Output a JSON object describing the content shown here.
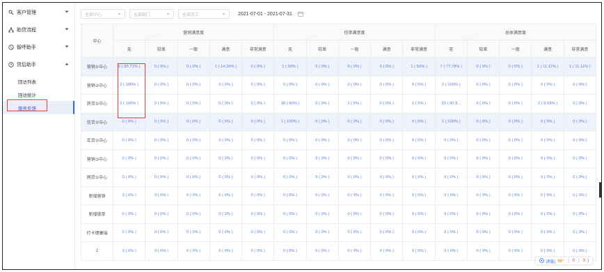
{
  "sidebar": {
    "items": [
      {
        "label": "客户管理",
        "icon": "search-user-icon",
        "expanded": false
      },
      {
        "label": "助贷流程",
        "icon": "org-tree-icon",
        "expanded": false
      },
      {
        "label": "智呼助手",
        "icon": "phone-icon",
        "expanded": false
      },
      {
        "label": "贷后助手",
        "icon": "clock-icon",
        "expanded": true
      }
    ],
    "sub_items": [
      {
        "label": "回访列表",
        "active": false
      },
      {
        "label": "回访统计",
        "active": false
      },
      {
        "label": "服务反馈",
        "active": true
      }
    ]
  },
  "filters": {
    "center_placeholder": "全部中心",
    "dept_placeholder": "全部部门",
    "staff_placeholder": "全部员工",
    "date_range": "2021-07-01 - 2021-07-31"
  },
  "table": {
    "center_header": "中心",
    "groups": [
      "营销满意度",
      "信审满意度",
      "总体满意度"
    ],
    "sub_headers": [
      "无",
      "较差",
      "一般",
      "满意",
      "非常满意"
    ],
    "rows": [
      {
        "name": "营销①中心",
        "highlight": true,
        "cells": [
          "6 ( 85.71% )",
          "0 ( 0% )",
          "0 ( 0% )",
          "1 ( 14.29% )",
          "0 ( 0% )",
          "1 ( 50% )",
          "0 ( 0% )",
          "0 ( 0% )",
          "0 ( 0% )",
          "1 ( 50% )",
          "7 ( 77.78% )",
          "0 ( 0% )",
          "0 ( 0% )",
          "1 ( 11.11% )",
          "1 ( 11.11% )"
        ]
      },
      {
        "name": "营销②中心",
        "highlight": false,
        "cells": [
          "2 ( 100% )",
          "0 ( 0% )",
          "0 ( 0% )",
          "0 ( 0% )",
          "0 ( 0% )",
          "0 ( 0% )",
          "0 ( 0% )",
          "0 ( 0% )",
          "0 ( 0% )",
          "0 ( 0% )",
          "2 ( 100% )",
          "0 ( 0% )",
          "0 ( 0% )",
          "0 ( 0% )",
          "0 ( 0% )"
        ]
      },
      {
        "name": "房贷①中心",
        "highlight": false,
        "cells": [
          "2 ( 100% )",
          "0 ( 0% )",
          "0 ( 0% )",
          "0 ( 0% )",
          "0 ( 0% )",
          "18 ( 90% )",
          "0 ( 0% )",
          "1 ( 5% )",
          "0 ( 0% )",
          "1 ( 5% )",
          "20 ( 90.9...",
          "0 ( 0% )",
          "0 ( 0% )",
          "2 ( 9.09% )",
          "0 ( 0% )"
        ]
      },
      {
        "name": "信贷①中心",
        "highlight": true,
        "cells": [
          "0 ( 0% )",
          "0 ( 0% )",
          "0 ( 0% )",
          "0 ( 0% )",
          "0 ( 0% )",
          "1 ( 100% )",
          "0 ( 0% )",
          "0 ( 0% )",
          "0 ( 0% )",
          "0 ( 0% )",
          "1 ( 100% )",
          "0 ( 0% )",
          "0 ( 0% )",
          "0 ( 0% )",
          "0 ( 0% )"
        ]
      },
      {
        "name": "车贷①中心",
        "highlight": false,
        "cells": [
          "0 ( 0% )",
          "0 ( 0% )",
          "0 ( 0% )",
          "0 ( 0% )",
          "0 ( 0% )",
          "0 ( 0% )",
          "0 ( 0% )",
          "0 ( 0% )",
          "0 ( 0% )",
          "0 ( 0% )",
          "0 ( 0% )",
          "0 ( 0% )",
          "0 ( 0% )",
          "0 ( 0% )",
          "0 ( 0% )"
        ]
      },
      {
        "name": "营销③中心",
        "highlight": false,
        "cells": [
          "0 ( 0% )",
          "0 ( 0% )",
          "0 ( 0% )",
          "0 ( 0% )",
          "0 ( 0% )",
          "0 ( 0% )",
          "0 ( 0% )",
          "0 ( 0% )",
          "0 ( 0% )",
          "0 ( 0% )",
          "0 ( 0% )",
          "0 ( 0% )",
          "0 ( 0% )",
          "0 ( 0% )",
          "0 ( 0% )"
        ]
      },
      {
        "name": "网贷①中心",
        "highlight": false,
        "cells": [
          "0 ( 0% )",
          "0 ( 0% )",
          "0 ( 0% )",
          "0 ( 0% )",
          "0 ( 0% )",
          "0 ( 0% )",
          "0 ( 0% )",
          "0 ( 0% )",
          "0 ( 0% )",
          "0 ( 0% )",
          "0 ( 0% )",
          "0 ( 0% )",
          "0 ( 0% )",
          "0 ( 0% )",
          "0 ( 0% )"
        ]
      },
      {
        "name": "新增营销",
        "highlight": false,
        "cells": [
          "0 ( 0% )",
          "0 ( 0% )",
          "0 ( 0% )",
          "0 ( 0% )",
          "0 ( 0% )",
          "0 ( 0% )",
          "0 ( 0% )",
          "0 ( 0% )",
          "0 ( 0% )",
          "0 ( 0% )",
          "0 ( 0% )",
          "0 ( 0% )",
          "0 ( 0% )",
          "0 ( 0% )",
          "0 ( 0% )"
        ]
      },
      {
        "name": "新增做单",
        "highlight": false,
        "cells": [
          "0 ( 0% )",
          "0 ( 0% )",
          "0 ( 0% )",
          "0 ( 0% )",
          "0 ( 0% )",
          "0 ( 0% )",
          "0 ( 0% )",
          "0 ( 0% )",
          "0 ( 0% )",
          "0 ( 0% )",
          "0 ( 0% )",
          "0 ( 0% )",
          "0 ( 0% )",
          "0 ( 0% )",
          "0 ( 0% )"
        ]
      },
      {
        "name": "打卡键康瑞",
        "highlight": false,
        "cells": [
          "0 ( 0% )",
          "0 ( 0% )",
          "0 ( 0% )",
          "0 ( 0% )",
          "0 ( 0% )",
          "0 ( 0% )",
          "0 ( 0% )",
          "0 ( 0% )",
          "0 ( 0% )",
          "0 ( 0% )",
          "0 ( 0% )",
          "0 ( 0% )",
          "0 ( 0% )",
          "0 ( 0% )",
          "0 ( 0% )"
        ]
      },
      {
        "name": "2",
        "highlight": false,
        "cells": [
          "0 ( 0% )",
          "0 ( 0% )",
          "0 ( 0% )",
          "0 ( 0% )",
          "0 ( 0% )",
          "0 ( 0% )",
          "0 ( 0% )",
          "0 ( 0% )",
          "0 ( 0% )",
          "0 ( 0% )",
          "0 ( 0% )",
          "0 ( 0% )",
          "0 ( 0% )",
          "0 ( 0% )",
          "0 ( 0% )"
        ]
      }
    ]
  },
  "status": {
    "label": "消息(",
    "count1": "99⁺",
    "sep": "|",
    "count2": "0",
    "count3": "0",
    "end": ")"
  },
  "colors": {
    "accent": "#2d6be8",
    "highlight_row": "#eef2fb",
    "annotation_red": "#e23b3b"
  }
}
